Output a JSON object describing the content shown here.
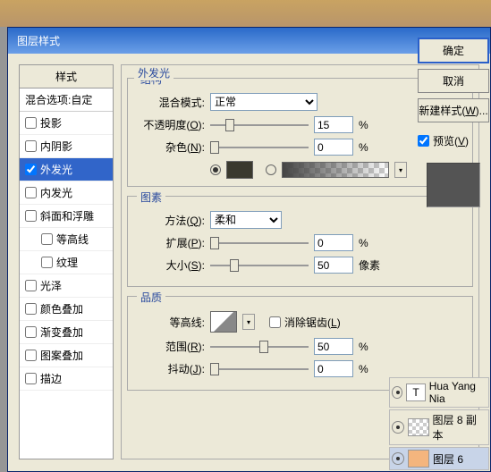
{
  "dialog": {
    "title": "图层样式"
  },
  "styles": {
    "header": "样式",
    "blend_options": "混合选项:自定",
    "items": [
      {
        "label": "投影",
        "checked": false
      },
      {
        "label": "内阴影",
        "checked": false
      },
      {
        "label": "外发光",
        "checked": true,
        "selected": true
      },
      {
        "label": "内发光",
        "checked": false
      },
      {
        "label": "斜面和浮雕",
        "checked": false
      },
      {
        "label": "等高线",
        "checked": false,
        "indent": true
      },
      {
        "label": "纹理",
        "checked": false,
        "indent": true
      },
      {
        "label": "光泽",
        "checked": false
      },
      {
        "label": "颜色叠加",
        "checked": false
      },
      {
        "label": "渐变叠加",
        "checked": false
      },
      {
        "label": "图案叠加",
        "checked": false
      },
      {
        "label": "描边",
        "checked": false
      }
    ]
  },
  "outer_glow": {
    "title": "外发光",
    "structure": {
      "title": "结构",
      "blend_mode_label": "混合模式:",
      "blend_mode_value": "正常",
      "opacity_label": "不透明度(O):",
      "opacity_value": "15",
      "opacity_unit": "%",
      "noise_label": "杂色(N):",
      "noise_value": "0",
      "noise_unit": "%",
      "color_hex": "#3a392e"
    },
    "elements": {
      "title": "图素",
      "technique_label": "方法(Q):",
      "technique_value": "柔和",
      "spread_label": "扩展(P):",
      "spread_value": "0",
      "spread_unit": "%",
      "size_label": "大小(S):",
      "size_value": "50",
      "size_unit": "像素"
    },
    "quality": {
      "title": "品质",
      "contour_label": "等高线:",
      "antialias_label": "消除锯齿(L)",
      "range_label": "范围(R):",
      "range_value": "50",
      "range_unit": "%",
      "jitter_label": "抖动(J):",
      "jitter_value": "0",
      "jitter_unit": "%"
    }
  },
  "buttons": {
    "ok": "确定",
    "cancel": "取消",
    "new_style": "新建样式(W)...",
    "preview": "预览(V)"
  },
  "layers": [
    {
      "name": "Hua Yang Nia",
      "type": "text"
    },
    {
      "name": "图层 8 副本",
      "type": "copy"
    },
    {
      "name": "图层 6",
      "type": "orange",
      "selected": true
    }
  ]
}
